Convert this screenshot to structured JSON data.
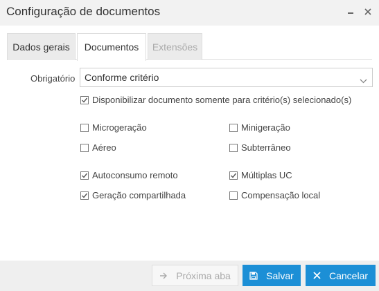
{
  "window": {
    "title": "Configuração de documentos"
  },
  "tabs": [
    {
      "label": "Dados gerais",
      "state": "inactive"
    },
    {
      "label": "Documentos",
      "state": "active"
    },
    {
      "label": "Extensões",
      "state": "disabled"
    }
  ],
  "form": {
    "obrigatorio_label": "Obrigatório",
    "obrigatorio_value": "Conforme critério",
    "disponibilizar": {
      "label": "Disponibilizar documento somente para critério(s) selecionado(s)",
      "checked": true
    },
    "criteria": [
      {
        "label": "Microgeração",
        "checked": false
      },
      {
        "label": "Minigeração",
        "checked": false
      },
      {
        "label": "Aéreo",
        "checked": false
      },
      {
        "label": "Subterrâneo",
        "checked": false
      },
      {
        "label": "Autoconsumo remoto",
        "checked": true
      },
      {
        "label": "Múltiplas UC",
        "checked": true
      },
      {
        "label": "Geração compartilhada",
        "checked": true
      },
      {
        "label": "Compensação local",
        "checked": false
      }
    ]
  },
  "footer": {
    "next_label": "Próxima aba",
    "save_label": "Salvar",
    "cancel_label": "Cancelar"
  },
  "colors": {
    "primary_button": "#1c8fd6",
    "titlebar_bg": "#f2f2f2",
    "footer_bg": "#efefef"
  }
}
